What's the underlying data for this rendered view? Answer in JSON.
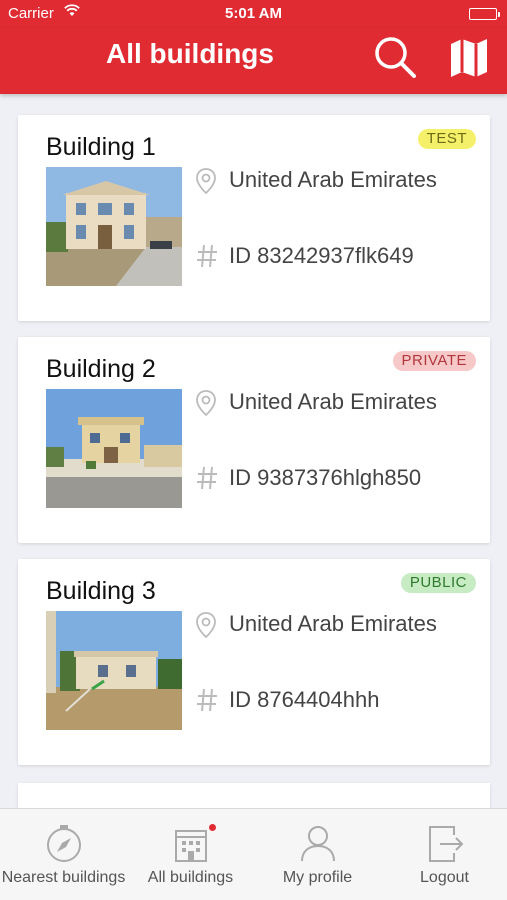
{
  "status_bar": {
    "carrier": "Carrier",
    "time": "5:01 AM"
  },
  "header": {
    "title": "All buildings",
    "search_icon": "search-icon",
    "map_icon": "map-icon"
  },
  "buildings": [
    {
      "name": "Building 1",
      "tag": "TEST",
      "tag_color": "#f5f06a",
      "tag_text_color": "#6d6a17",
      "location": "United Arab Emirates",
      "id": "ID 83242937flk649"
    },
    {
      "name": "Building 2",
      "tag": "PRIVATE",
      "tag_color": "#f7c8c8",
      "tag_text_color": "#b2363c",
      "location": "United Arab Emirates",
      "id": "ID 9387376hlgh850"
    },
    {
      "name": "Building 3",
      "tag": "PUBLIC",
      "tag_color": "#c7ecc4",
      "tag_text_color": "#2f7a2d",
      "location": "United Arab Emirates",
      "id": "ID 8764404hhh"
    }
  ],
  "tabs": [
    {
      "label": "Nearest buildings",
      "icon": "compass-icon"
    },
    {
      "label": "All buildings",
      "icon": "building-icon",
      "active": true
    },
    {
      "label": "My profile",
      "icon": "person-icon"
    },
    {
      "label": "Logout",
      "icon": "logout-icon"
    }
  ],
  "colors": {
    "brand": "#e02b33",
    "background": "#eef0f5"
  }
}
